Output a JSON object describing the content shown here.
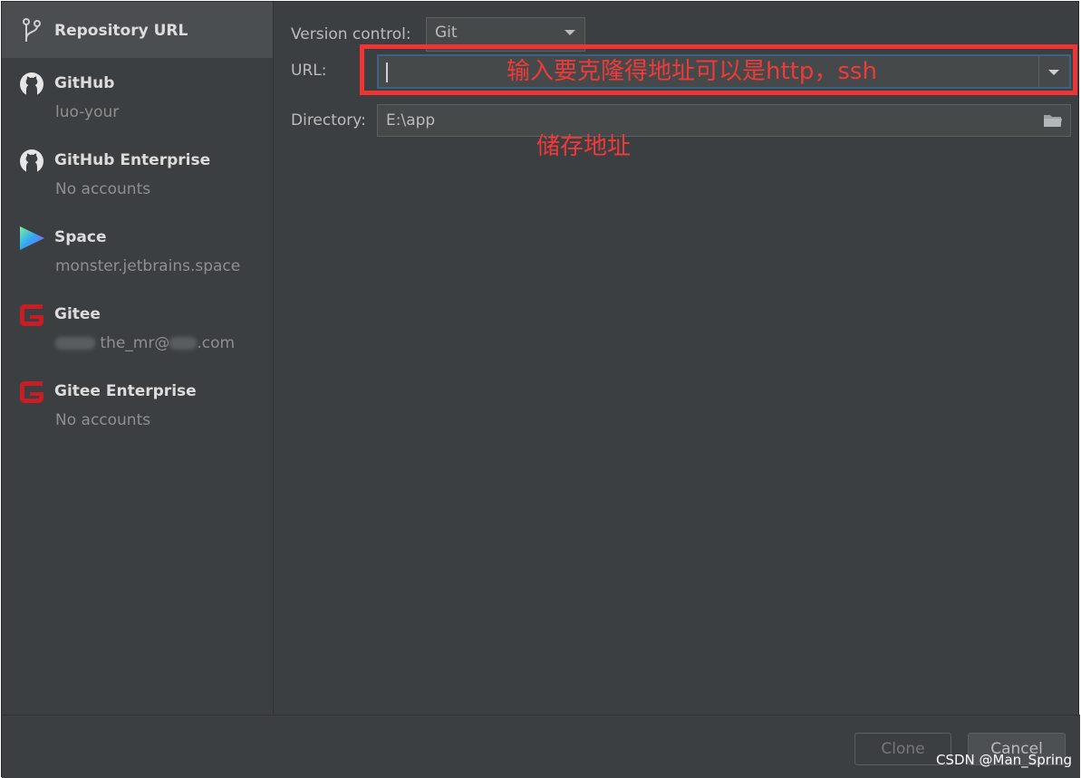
{
  "sidebar": {
    "items": [
      {
        "title": "Repository URL",
        "subtitle": "",
        "icon": "vcs-branch-icon"
      },
      {
        "title": "GitHub",
        "subtitle": "luo-your",
        "icon": "github-icon"
      },
      {
        "title": "GitHub Enterprise",
        "subtitle": "No accounts",
        "icon": "github-icon"
      },
      {
        "title": "Space",
        "subtitle": "monster.jetbrains.space",
        "icon": "space-icon"
      },
      {
        "title": "Gitee",
        "subtitle_visible": "the_mr@",
        "subtitle_suffix": ".com",
        "icon": "gitee-icon"
      },
      {
        "title": "Gitee Enterprise",
        "subtitle": "No accounts",
        "icon": "gitee-icon"
      }
    ]
  },
  "form": {
    "version_control_label": "Version control:",
    "version_control_value": "Git",
    "url_label": "URL:",
    "url_value": "",
    "directory_label": "Directory:",
    "directory_value": "E:\\app"
  },
  "annotations": {
    "url_note": "输入要克隆得地址可以是http，ssh",
    "directory_note": "储存地址",
    "color": "#ee3a3a"
  },
  "footer": {
    "clone_label": "Clone",
    "cancel_label": "Cancel"
  },
  "watermark": "CSDN @Man_Spring",
  "colors": {
    "background": "#3c3f41",
    "selected": "#4b4e51",
    "gitee_red": "#c71d23"
  }
}
